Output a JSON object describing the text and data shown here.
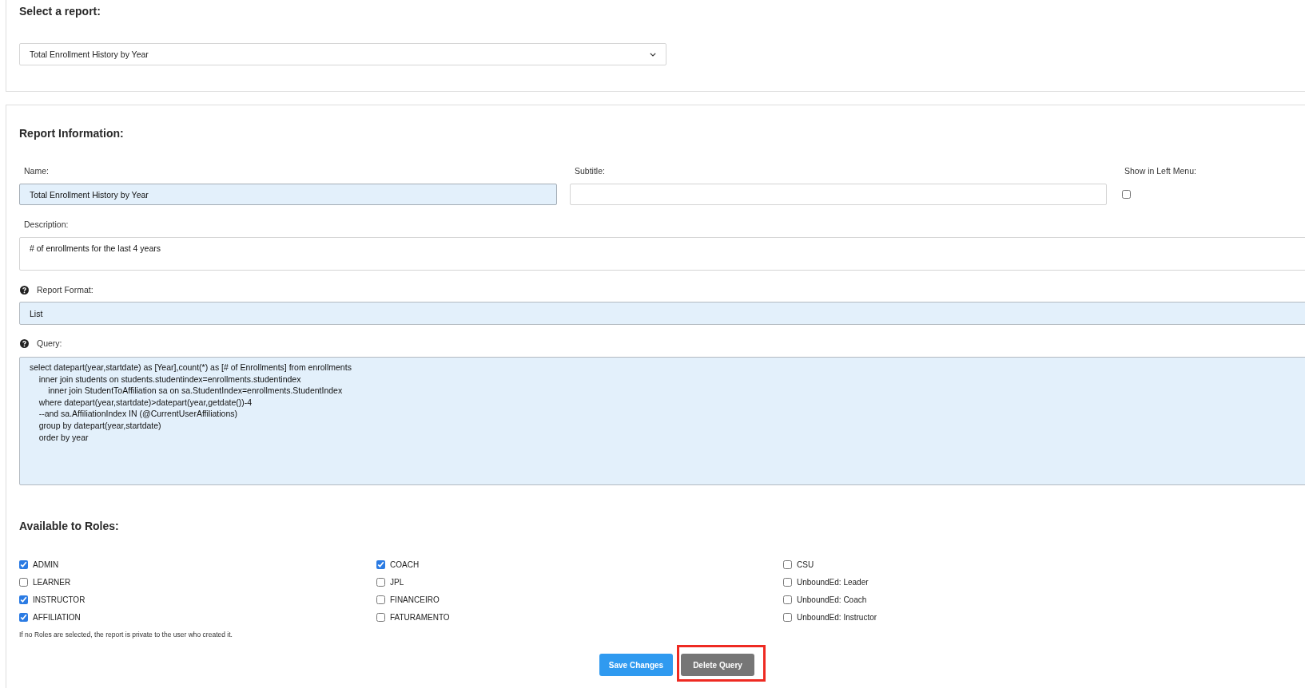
{
  "report_selector": {
    "title": "Select a report:",
    "value": "Total Enrollment History by Year"
  },
  "report_information": {
    "title": "Report Information:",
    "name": {
      "label": "Name:",
      "value": "Total Enrollment History by Year"
    },
    "subtitle": {
      "label": "Subtitle:"
    },
    "show_in_left_menu": {
      "label": "Show in Left Menu:",
      "checked": false
    },
    "description": {
      "label": "Description:",
      "value": "# of enrollments for the last 4 years"
    },
    "report_format": {
      "label": "Report Format:",
      "value": "List"
    },
    "query": {
      "label": "Query:",
      "value": "select datepart(year,startdate) as [Year],count(*) as [# of Enrollments] from enrollments\n    inner join students on students.studentindex=enrollments.studentindex\n        inner join StudentToAffiliation sa on sa.StudentIndex=enrollments.StudentIndex\n    where datepart(year,startdate)>datepart(year,getdate())-4\n    --and sa.AffiliationIndex IN (@CurrentUserAffiliations)\n    group by datepart(year,startdate)\n    order by year"
    }
  },
  "roles": {
    "title": "Available to Roles:",
    "columns": [
      {
        "items": [
          {
            "label": "ADMIN",
            "checked": true
          },
          {
            "label": "LEARNER",
            "checked": false
          },
          {
            "label": "INSTRUCTOR",
            "checked": true
          },
          {
            "label": "AFFILIATION",
            "checked": true
          }
        ]
      },
      {
        "items": [
          {
            "label": "COACH",
            "checked": true
          },
          {
            "label": "JPL",
            "checked": false
          },
          {
            "label": "FINANCEIRO",
            "checked": false
          },
          {
            "label": "FATURAMENTO",
            "checked": false
          }
        ]
      },
      {
        "items": [
          {
            "label": "CSU",
            "checked": false
          },
          {
            "label": "UnboundEd: Leader",
            "checked": false
          },
          {
            "label": "UnboundEd: Coach",
            "checked": false
          },
          {
            "label": "UnboundEd: Instructor",
            "checked": false
          }
        ]
      }
    ],
    "note": "If no Roles are selected, the report is private to the user who created it."
  },
  "buttons": [
    {
      "label": "Save Changes",
      "kind": "primary",
      "highlighted": false
    },
    {
      "label": "Delete Query",
      "kind": "secondary",
      "highlighted": true
    }
  ]
}
